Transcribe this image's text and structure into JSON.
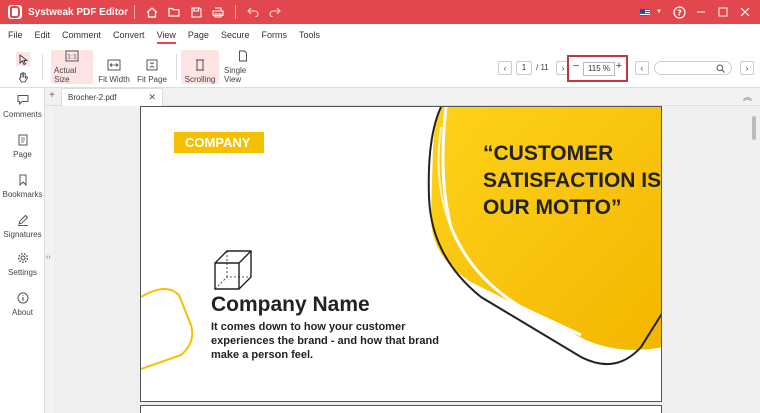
{
  "app": {
    "title": "Systweak PDF Editor"
  },
  "menu": [
    "File",
    "Edit",
    "Comment",
    "Convert",
    "View",
    "Page",
    "Secure",
    "Forms",
    "Tools"
  ],
  "menu_active": "View",
  "toolbar": {
    "actual_size": "Actual Size",
    "fit_width": "Fit Width",
    "fit_page": "Fit Page",
    "scrolling": "Scrolling",
    "single_view": "Single View",
    "page_current": "1",
    "page_total": "/ 11",
    "zoom": "115 %"
  },
  "sidebar": {
    "comments": "Comments",
    "page": "Page",
    "bookmarks": "Bookmarks",
    "signatures": "Signatures",
    "settings": "Settings",
    "about": "About"
  },
  "tab": {
    "name": "Brocher-2.pdf"
  },
  "doc": {
    "badge": "COMPANY",
    "quote_line1": "“CUSTOMER",
    "quote_line2": "SATISFACTION IS",
    "quote_line3": "OUR MOTTO”",
    "company_name": "Company Name",
    "tagline": "It comes down to how your customer experiences the brand - and how that brand make a person feel."
  },
  "colors": {
    "titlebar": "#e2474d",
    "accent_yellow": "#f5c000",
    "highlight": "#c9353d"
  }
}
